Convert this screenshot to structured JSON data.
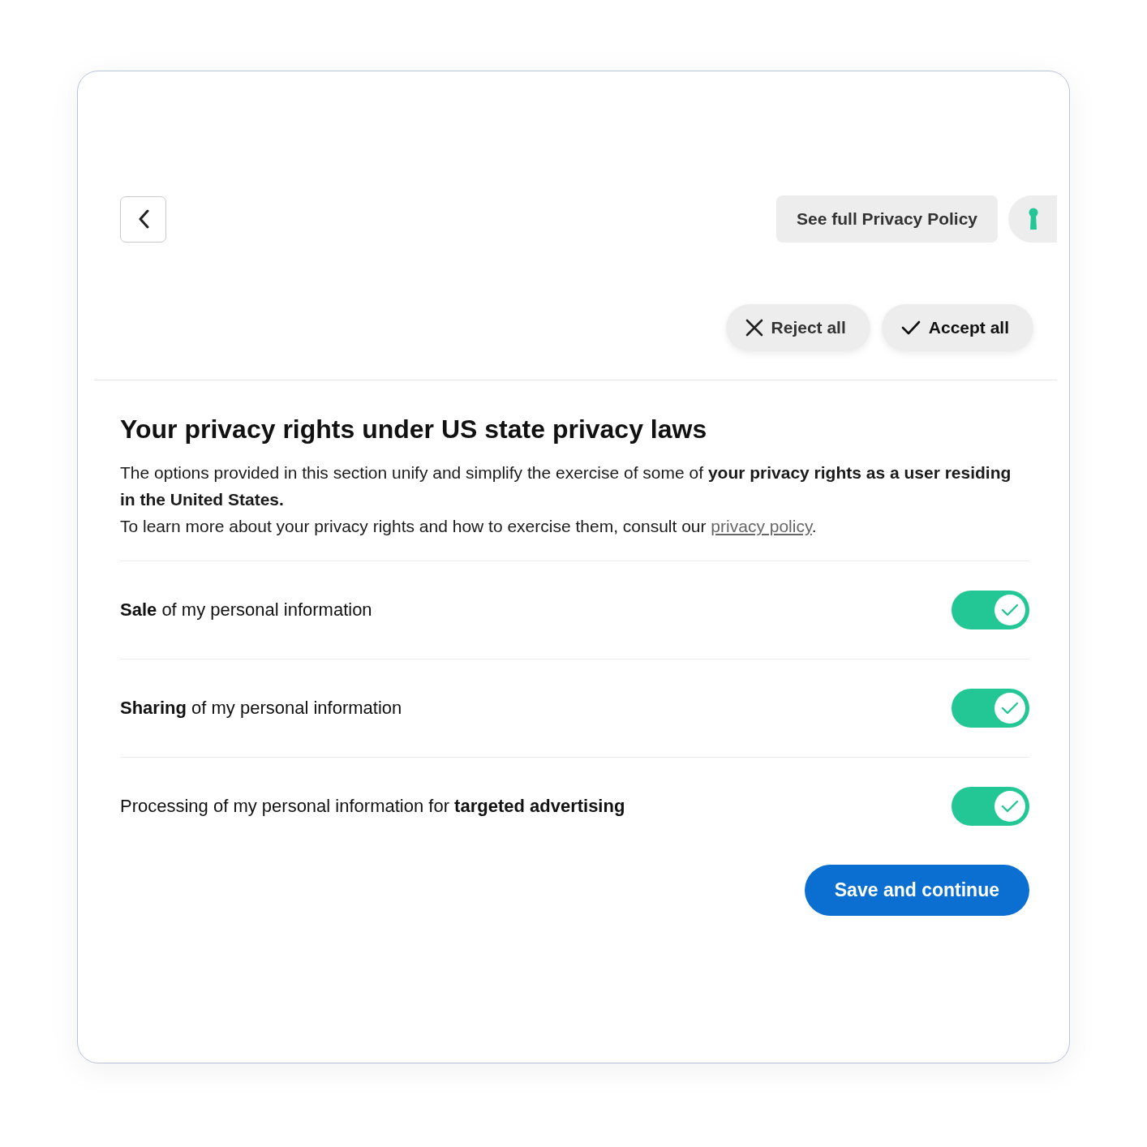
{
  "header": {
    "policy_button": "See full Privacy Policy"
  },
  "actions": [
    {
      "kind": "reject",
      "label": "Reject all"
    },
    {
      "kind": "accept",
      "label": "Accept all"
    }
  ],
  "section": {
    "title": "Your privacy rights under US state privacy laws",
    "intro": "The options provided in this section unify and simplify the exercise of some of **your privacy rights as a user residing in the United States.**",
    "learn_more": {
      "text": "To learn more about your privacy rights and how to exercise them, consult our ",
      "link": "privacy policy",
      "after": "."
    }
  },
  "toggles": [
    {
      "label": "**Sale** of my personal information",
      "on": true
    },
    {
      "label": "**Sharing** of my personal information",
      "on": true
    },
    {
      "label": "Processing of my personal information for **targeted advertising**",
      "on": true
    }
  ],
  "save_button": "Save and continue"
}
